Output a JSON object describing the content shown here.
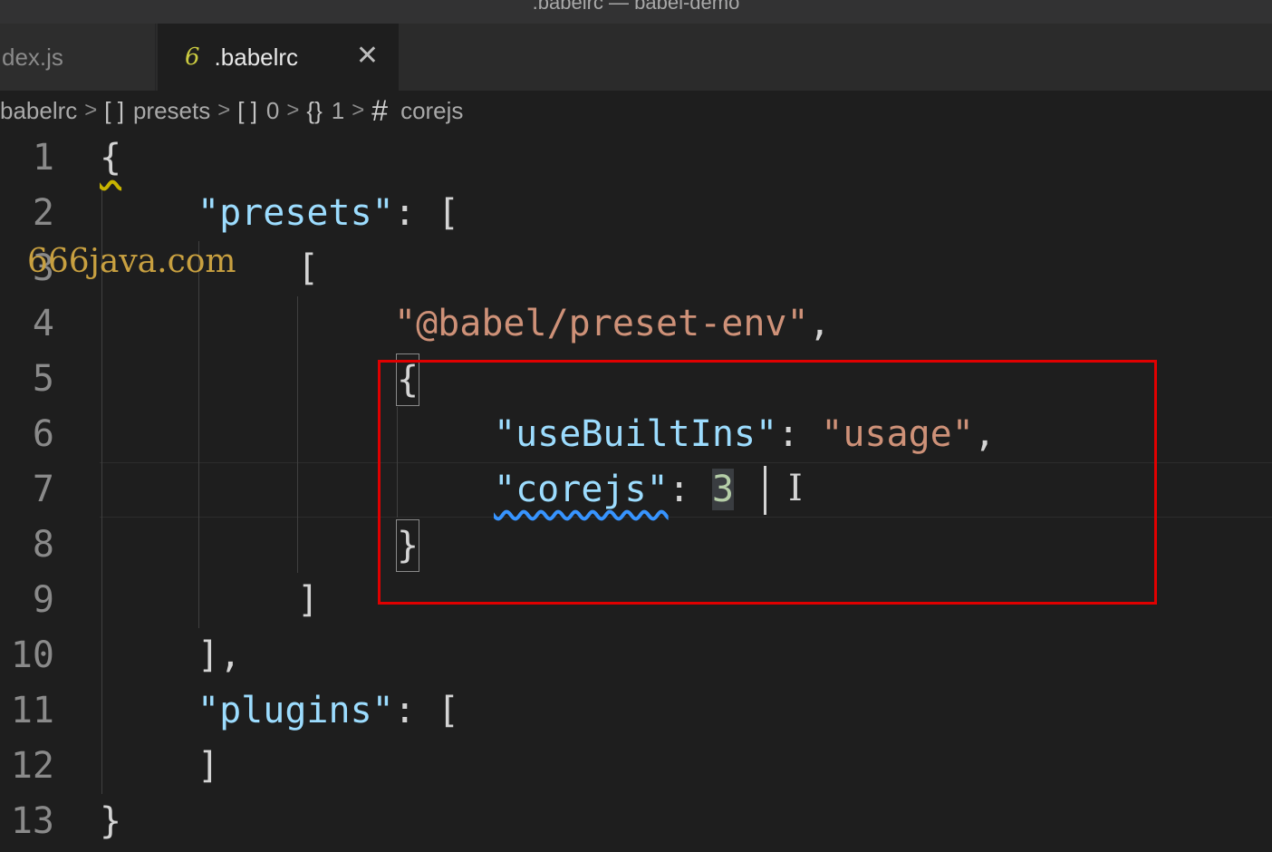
{
  "window": {
    "title": ".babelrc — babel-demo"
  },
  "tabs": [
    {
      "label": "dex.js",
      "active": false
    },
    {
      "label": ".babelrc",
      "active": true,
      "icon": "json-config-icon"
    }
  ],
  "breadcrumbs": {
    "file": "babelrc",
    "items": [
      {
        "icon": "[ ]",
        "label": "presets"
      },
      {
        "icon": "[ ]",
        "label": "0"
      },
      {
        "icon": "{}",
        "label": "1"
      },
      {
        "icon": "#",
        "label": "corejs"
      }
    ]
  },
  "watermark": "666java.com",
  "editor": {
    "line_numbers": [
      "1",
      "2",
      "3",
      "4",
      "5",
      "6",
      "7",
      "8",
      "9",
      "10",
      "11",
      "12",
      "13"
    ],
    "code": {
      "l1": "{",
      "l2_key": "\"presets\"",
      "l2_rest": ": [",
      "l3": "[",
      "l4_str": "\"@babel/preset-env\"",
      "l4_comma": ",",
      "l5": "{",
      "l6_key": "\"useBuiltIns\"",
      "l6_colon": ": ",
      "l6_val": "\"usage\"",
      "l6_comma": ",",
      "l7_key": "\"corejs\"",
      "l7_colon": ": ",
      "l7_val": "3",
      "l8": "}",
      "l9": "]",
      "l10": "],",
      "l11_key": "\"plugins\"",
      "l11_rest": ": [",
      "l12": "]",
      "l13": "}"
    }
  },
  "colors": {
    "key": "#9cdcfe",
    "string": "#ce9178",
    "number": "#b5cea8",
    "annotation_box": "#e00000"
  }
}
